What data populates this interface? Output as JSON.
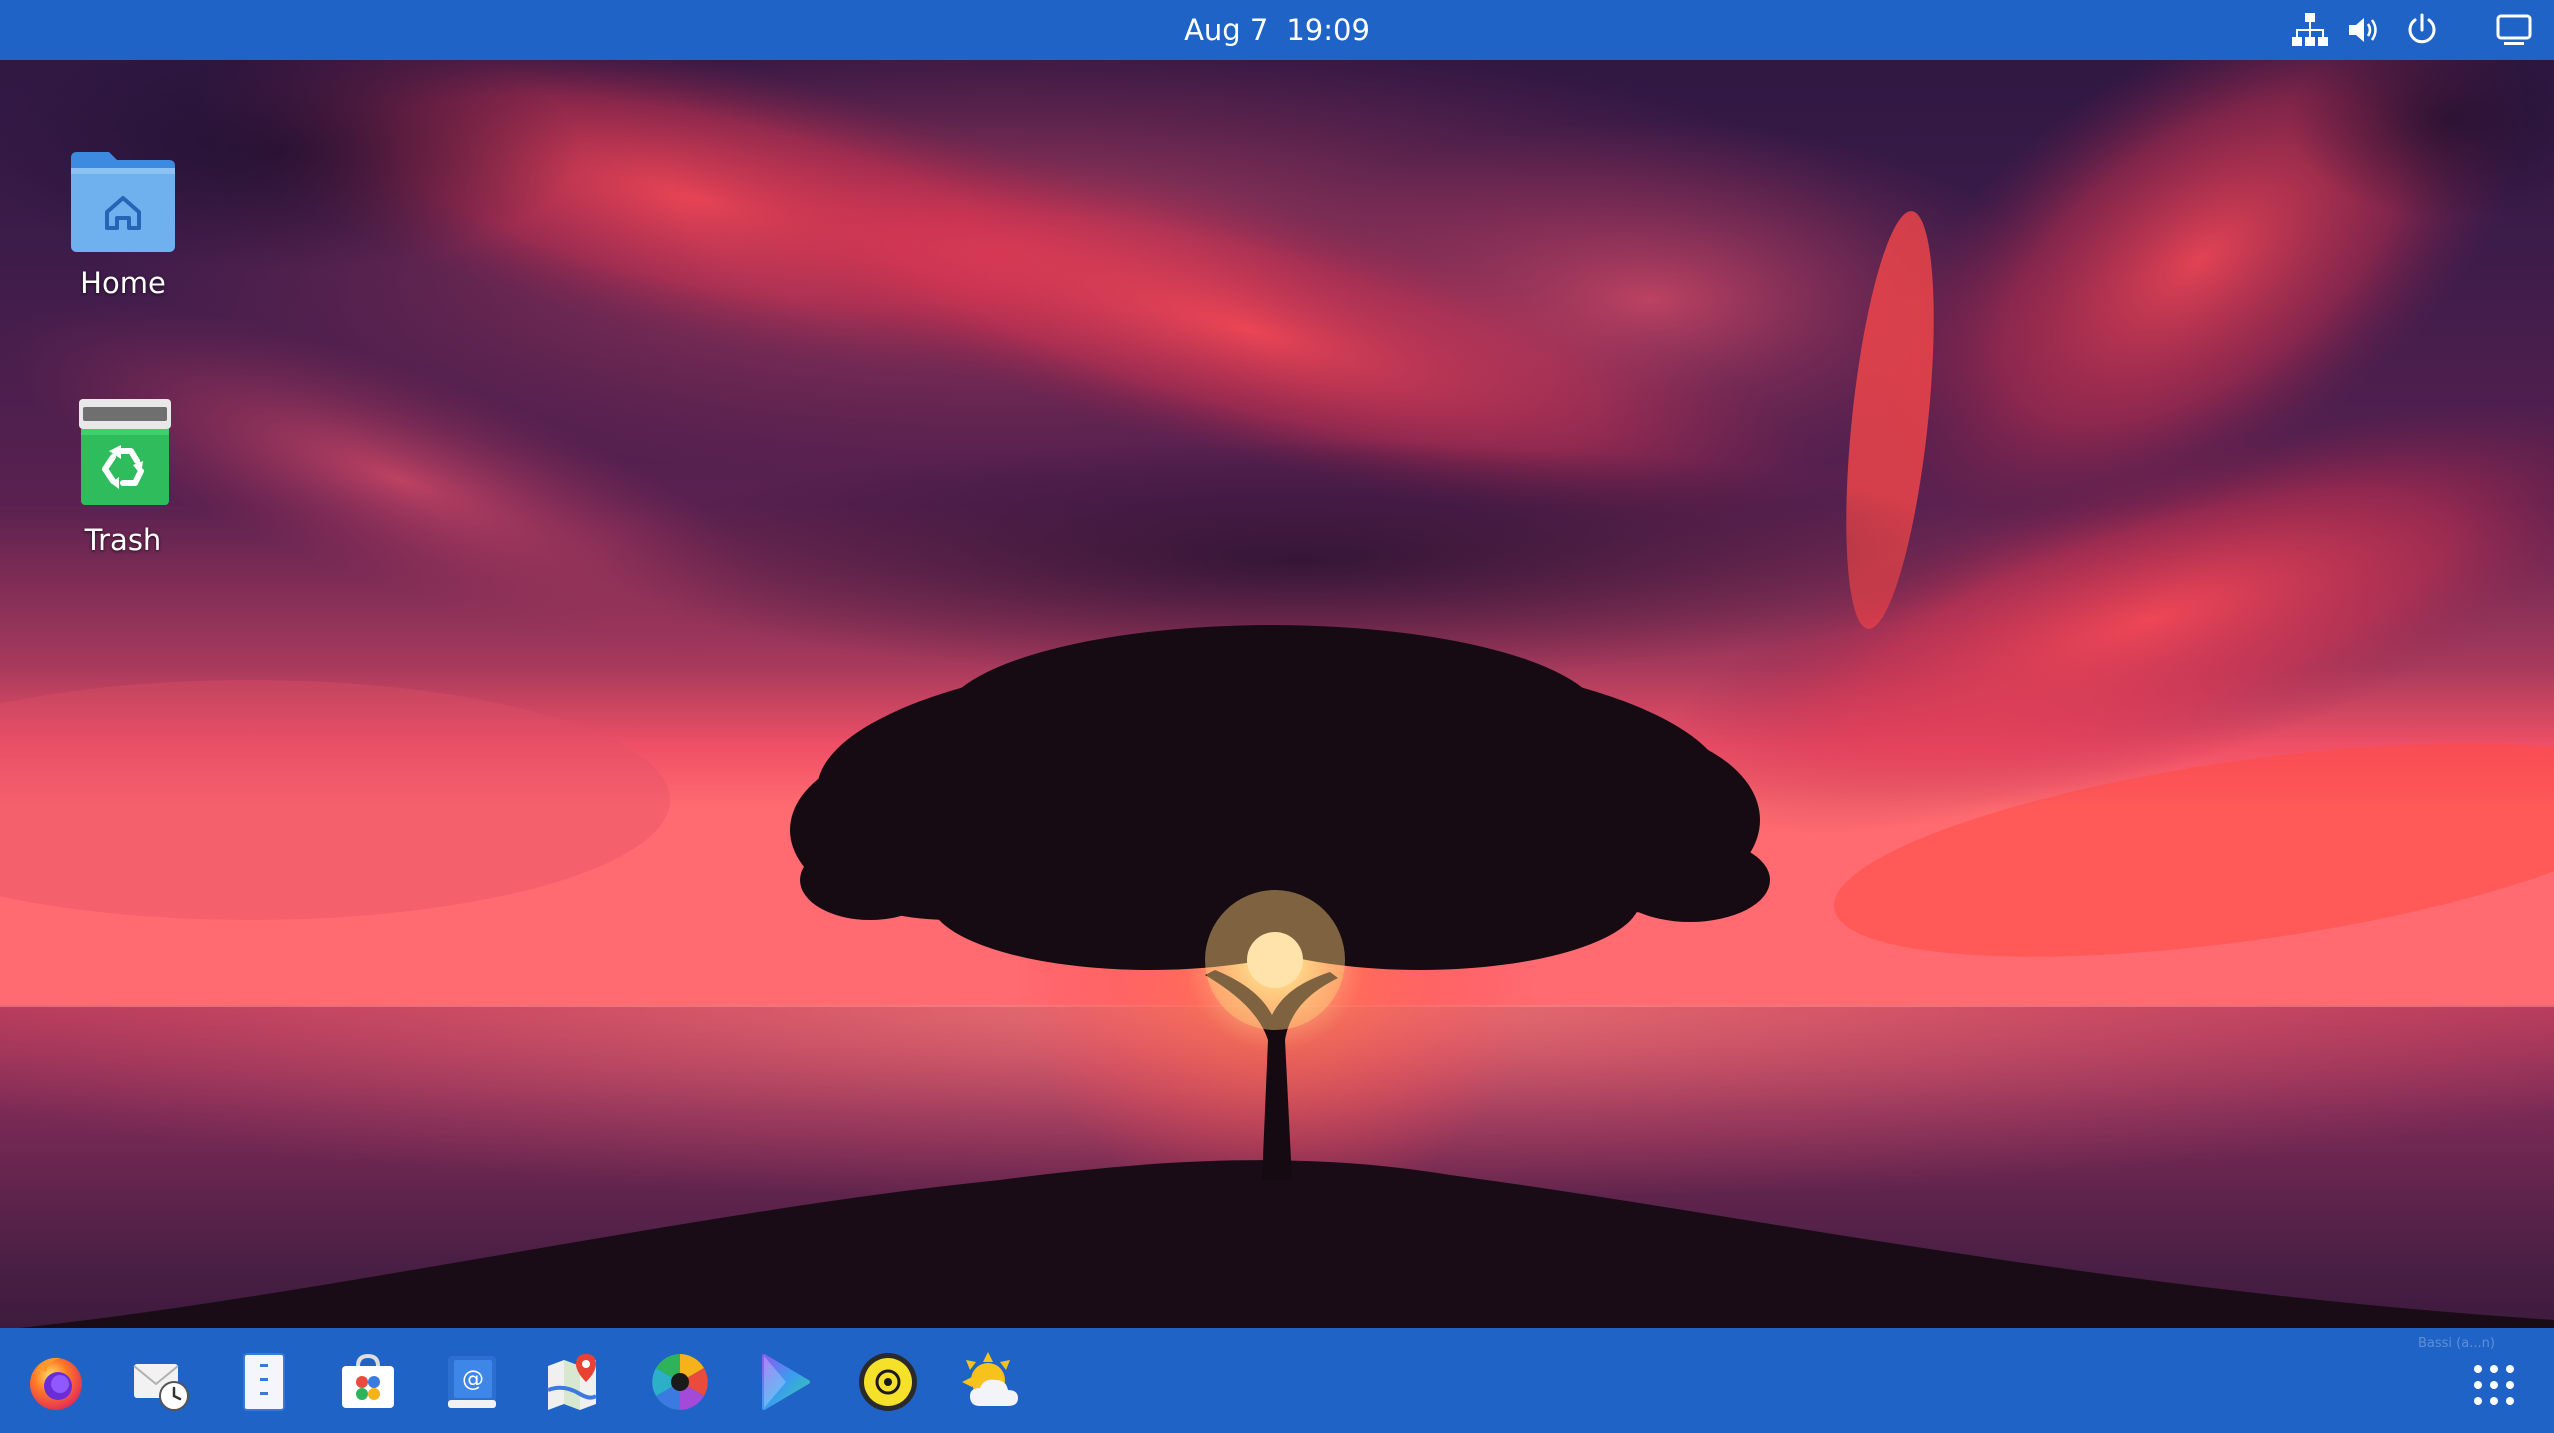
{
  "topbar": {
    "date": "Aug 7",
    "time": "19:09",
    "tray": [
      "network-icon",
      "volume-icon",
      "power-icon",
      "display-icon"
    ]
  },
  "desktop": {
    "icons": [
      {
        "label": "Home",
        "icon": "home-folder-icon"
      },
      {
        "label": "Trash",
        "icon": "trash-icon"
      }
    ]
  },
  "dock": {
    "apps": [
      {
        "name": "Firefox",
        "icon": "firefox-icon"
      },
      {
        "name": "Mail scheduler",
        "icon": "mail-clock-icon"
      },
      {
        "name": "Text editor",
        "icon": "text-editor-icon"
      },
      {
        "name": "Software store",
        "icon": "software-store-icon"
      },
      {
        "name": "Contacts",
        "icon": "contacts-icon"
      },
      {
        "name": "Maps",
        "icon": "maps-icon"
      },
      {
        "name": "Photos",
        "icon": "photos-icon"
      },
      {
        "name": "Videos",
        "icon": "videos-icon"
      },
      {
        "name": "Music",
        "icon": "music-icon"
      },
      {
        "name": "Weather",
        "icon": "weather-icon"
      }
    ],
    "watermark": "Bassi (a...n)",
    "show_apps": "apps-grid-icon"
  },
  "colors": {
    "panel": "#1f63c6",
    "sky_top": "#2b1640",
    "horizon": "#ff5a6e",
    "sun": "#fff1c8"
  }
}
